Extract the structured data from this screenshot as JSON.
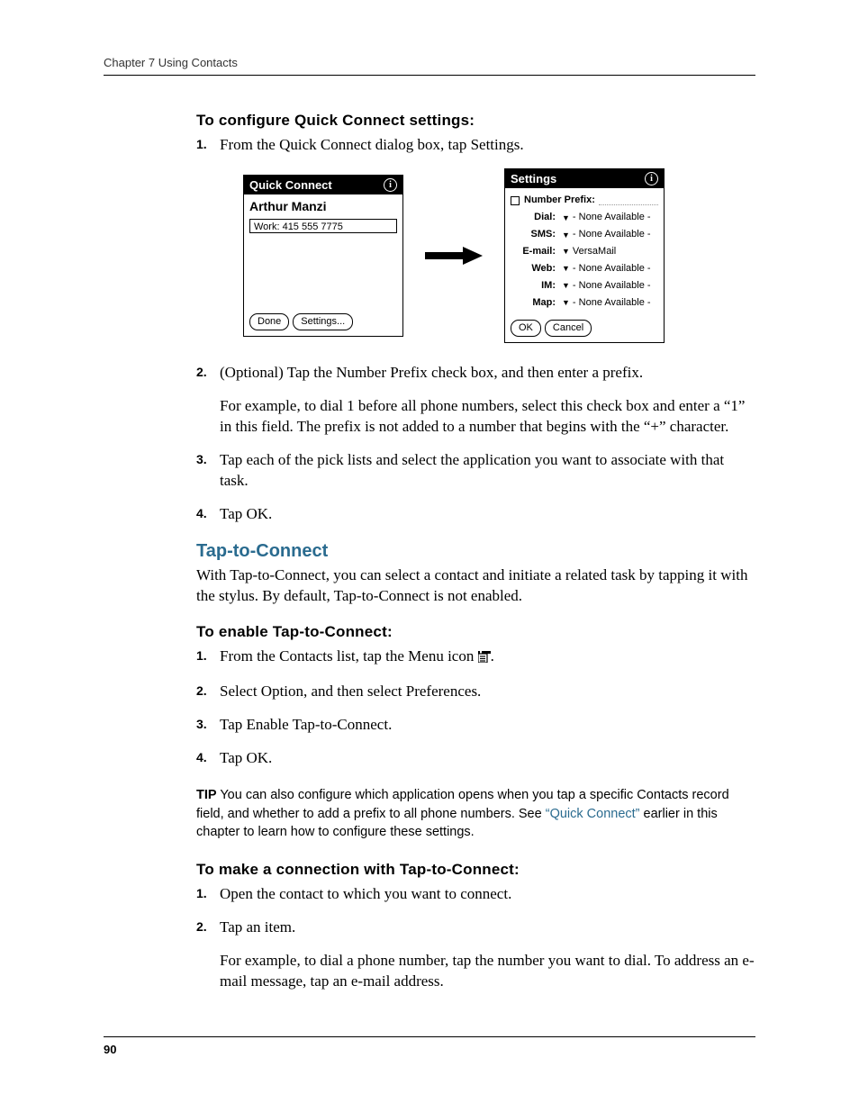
{
  "running_head": "Chapter 7    Using Contacts",
  "page_number": "90",
  "section1": {
    "heading": "To configure Quick Connect settings:",
    "step1": "From the Quick Connect dialog box, tap Settings.",
    "step2": "(Optional) Tap the Number Prefix check box, and then enter a prefix.",
    "step2_sub": "For example, to dial 1 before all phone numbers, select this check box and enter a “1” in this field. The prefix is not added to a number that begins with the “+” character.",
    "step3": "Tap each of the pick lists and select the application you want to associate with that task.",
    "step4": "Tap OK."
  },
  "fig_left": {
    "title": "Quick Connect",
    "name": "Arthur Manzi",
    "field1": "Work: 415 555 7775",
    "btn_done": "Done",
    "btn_settings": "Settings..."
  },
  "fig_right": {
    "title": "Settings",
    "prefix_label": "Number Prefix:",
    "rows": {
      "dial": {
        "lbl": "Dial:",
        "val": "- None Available -"
      },
      "sms": {
        "lbl": "SMS:",
        "val": "- None Available -"
      },
      "email": {
        "lbl": "E-mail:",
        "val": "VersaMail"
      },
      "web": {
        "lbl": "Web:",
        "val": "- None Available -"
      },
      "im": {
        "lbl": "IM:",
        "val": "- None Available -"
      },
      "map": {
        "lbl": "Map:",
        "val": "- None Available -"
      }
    },
    "btn_ok": "OK",
    "btn_cancel": "Cancel"
  },
  "tap_section": {
    "heading": "Tap-to-Connect",
    "intro": "With Tap-to-Connect, you can select a contact and initiate a related task by tapping it with the stylus. By default, Tap-to-Connect is not enabled."
  },
  "enable_section": {
    "heading": "To enable Tap-to-Connect:",
    "step1_pre": "From the Contacts list, tap the Menu icon ",
    "step1_post": ".",
    "step2": "Select Option, and then select Preferences.",
    "step3": "Tap Enable Tap-to-Connect.",
    "step4": "Tap OK."
  },
  "tip": {
    "label": "TIP",
    "text1": "   You can also configure which application opens when you tap a specific Contacts record field, and whether to add a prefix to all phone numbers. See ",
    "link": "“Quick Connect”",
    "text2": " earlier in this chapter to learn how to configure these settings."
  },
  "make_section": {
    "heading": "To make a connection with Tap-to-Connect:",
    "step1": "Open the contact to which you want to connect.",
    "step2": "Tap an item.",
    "step2_sub": "For example, to dial a phone number, tap the number you want to dial. To address an e-mail message, tap an e-mail address."
  }
}
